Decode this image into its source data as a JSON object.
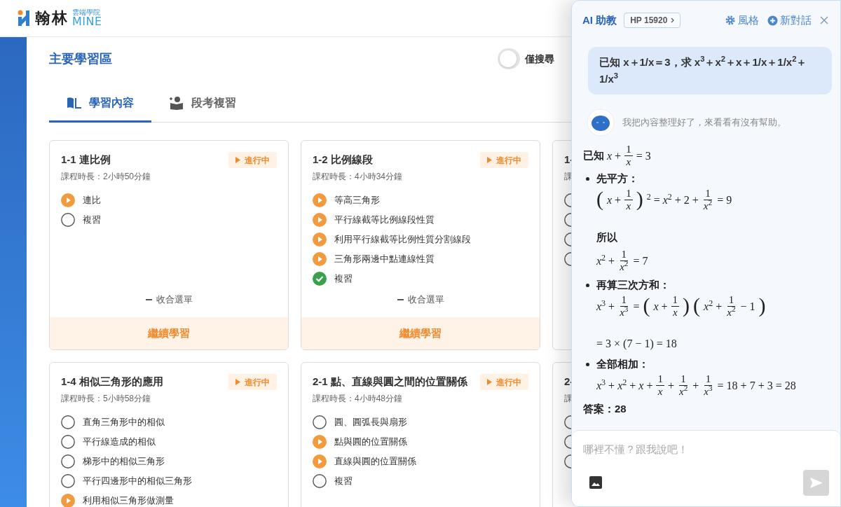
{
  "header": {
    "logo": {
      "name": "翰林",
      "tagline": "雲端學院",
      "brand": "MINE"
    }
  },
  "main": {
    "title": "主要學習區",
    "toggle": {
      "on": false,
      "label": "僅搜尋"
    },
    "tabs": [
      {
        "label": "學習內容",
        "selected": true,
        "kind": "book"
      },
      {
        "label": "段考複習",
        "selected": false,
        "kind": "reader"
      }
    ],
    "cards": [
      {
        "title": "1-1 連比例",
        "status": {
          "kind": "in_progress",
          "label": "進行中"
        },
        "duration": "課程時長：2小時50分鐘",
        "items": [
          {
            "label": "連比",
            "kind": "playing"
          },
          {
            "label": "複習",
            "kind": "todo"
          }
        ],
        "collapse": "收合選單",
        "action": "繼續學習"
      },
      {
        "title": "1-2 比例線段",
        "status": {
          "kind": "in_progress",
          "label": "進行中"
        },
        "duration": "課程時長：4小時34分鐘",
        "items": [
          {
            "label": "等高三角形",
            "kind": "playing"
          },
          {
            "label": "平行線截等比例線段性質",
            "kind": "playing"
          },
          {
            "label": "利用平行線截等比例性質分割線段",
            "kind": "playing"
          },
          {
            "label": "三角形兩邊中點連線性質",
            "kind": "playing"
          },
          {
            "label": "複習",
            "kind": "done"
          }
        ],
        "collapse": "收合選單",
        "action": "繼續學習"
      },
      {
        "title": "1-",
        "duration": "課",
        "items": [
          {
            "kind": "todo"
          },
          {
            "kind": "todo"
          },
          {
            "kind": "todo"
          },
          {
            "kind": "todo"
          }
        ]
      },
      {
        "title": "1-4 相似三角形的應用",
        "status": {
          "kind": "in_progress",
          "label": "進行中"
        },
        "duration": "課程時長：5小時58分鐘",
        "items": [
          {
            "label": "直角三角形中的相似",
            "kind": "todo"
          },
          {
            "label": "平行線造成的相似",
            "kind": "todo"
          },
          {
            "label": "梯形中的相似三角形",
            "kind": "todo"
          },
          {
            "label": "平行四邊形中的相似三角形",
            "kind": "todo"
          },
          {
            "label": "利用相似三角形做測量",
            "kind": "playing"
          }
        ]
      },
      {
        "title": "2-1 點、直線與圓之間的位置關係",
        "status": {
          "kind": "in_progress",
          "label": "進行中"
        },
        "duration": "課程時長：4小時48分鐘",
        "items": [
          {
            "label": "圓、圓弧長與扇形",
            "kind": "todo"
          },
          {
            "label": "點與圓的位置關係",
            "kind": "playing"
          },
          {
            "label": "直線與圓的位置關係",
            "kind": "playing"
          },
          {
            "label": "複習",
            "kind": "todo"
          }
        ]
      },
      {
        "title": "2-",
        "duration": "課",
        "items": [
          {
            "kind": "todo"
          },
          {
            "kind": "todo"
          },
          {
            "kind": "todo"
          }
        ]
      }
    ]
  },
  "assistant": {
    "title": "AI 助教",
    "points": "HP 15920",
    "style_label": "風格",
    "new_chat_label": "新對話",
    "user_message": "已知 x＋1/x＝3，求 x$^{3}$＋x$^{2}$＋x＋1/x＋1/x$^{2}$＋1/x$^{3}$",
    "bot_intro": "我把內容整理好了，來看看有沒有幫助。",
    "answer": [
      {
        "kind": "given",
        "text": "已知",
        "math": [
          "*x* +",
          {
            "num": "1",
            "den": "*x*"
          },
          "= 3"
        ]
      },
      {
        "kind": "bullet",
        "text": "先平方：",
        "children": [
          {
            "kind": "math",
            "math": [
              {
                "big": "("
              },
              "*x* +",
              {
                "num": "1",
                "den": "*x*"
              },
              {
                "big": ")"
              },
              "$^{2}$ = *x*$^{2}$ + 2 +",
              {
                "num": "1",
                "den": "*x*$^{2}$"
              },
              "= 9"
            ]
          },
          {
            "kind": "text",
            "text": "所以"
          },
          {
            "kind": "math",
            "math": [
              "*x*$^{2}$ +",
              {
                "num": "1",
                "den": "*x*$^{2}$"
              },
              "= 7"
            ]
          }
        ]
      },
      {
        "kind": "bullet",
        "text": "再算三次方和：",
        "children": [
          {
            "kind": "math",
            "math": [
              "*x*$^{3}$ +",
              {
                "num": "1",
                "den": "*x*$^{3}$"
              },
              "=",
              {
                "big": "("
              },
              "*x* +",
              {
                "num": "1",
                "den": "*x*"
              },
              {
                "big": ")"
              },
              {
                "big": "("
              },
              "*x*$^{2}$ +",
              {
                "num": "1",
                "den": "*x*$^{2}$"
              },
              "− 1",
              {
                "big": ")"
              }
            ]
          },
          {
            "kind": "math",
            "math": [
              "= 3 × (7 − 1) = 18"
            ]
          }
        ]
      },
      {
        "kind": "bullet",
        "text": "全部相加：",
        "children": [
          {
            "kind": "math",
            "math": [
              "*x*$^{3}$ + *x*$^{2}$ + *x* +",
              {
                "num": "1",
                "den": "*x*"
              },
              "+",
              {
                "num": "1",
                "den": "*x*$^{2}$"
              },
              "+",
              {
                "num": "1",
                "den": "*x*$^{3}$"
              },
              "= 18 + 7 + 3 = 28"
            ]
          }
        ]
      },
      {
        "kind": "summary",
        "text": "答案：28"
      }
    ],
    "input": {
      "placeholder": "哪裡不懂？跟我說吧！"
    }
  }
}
